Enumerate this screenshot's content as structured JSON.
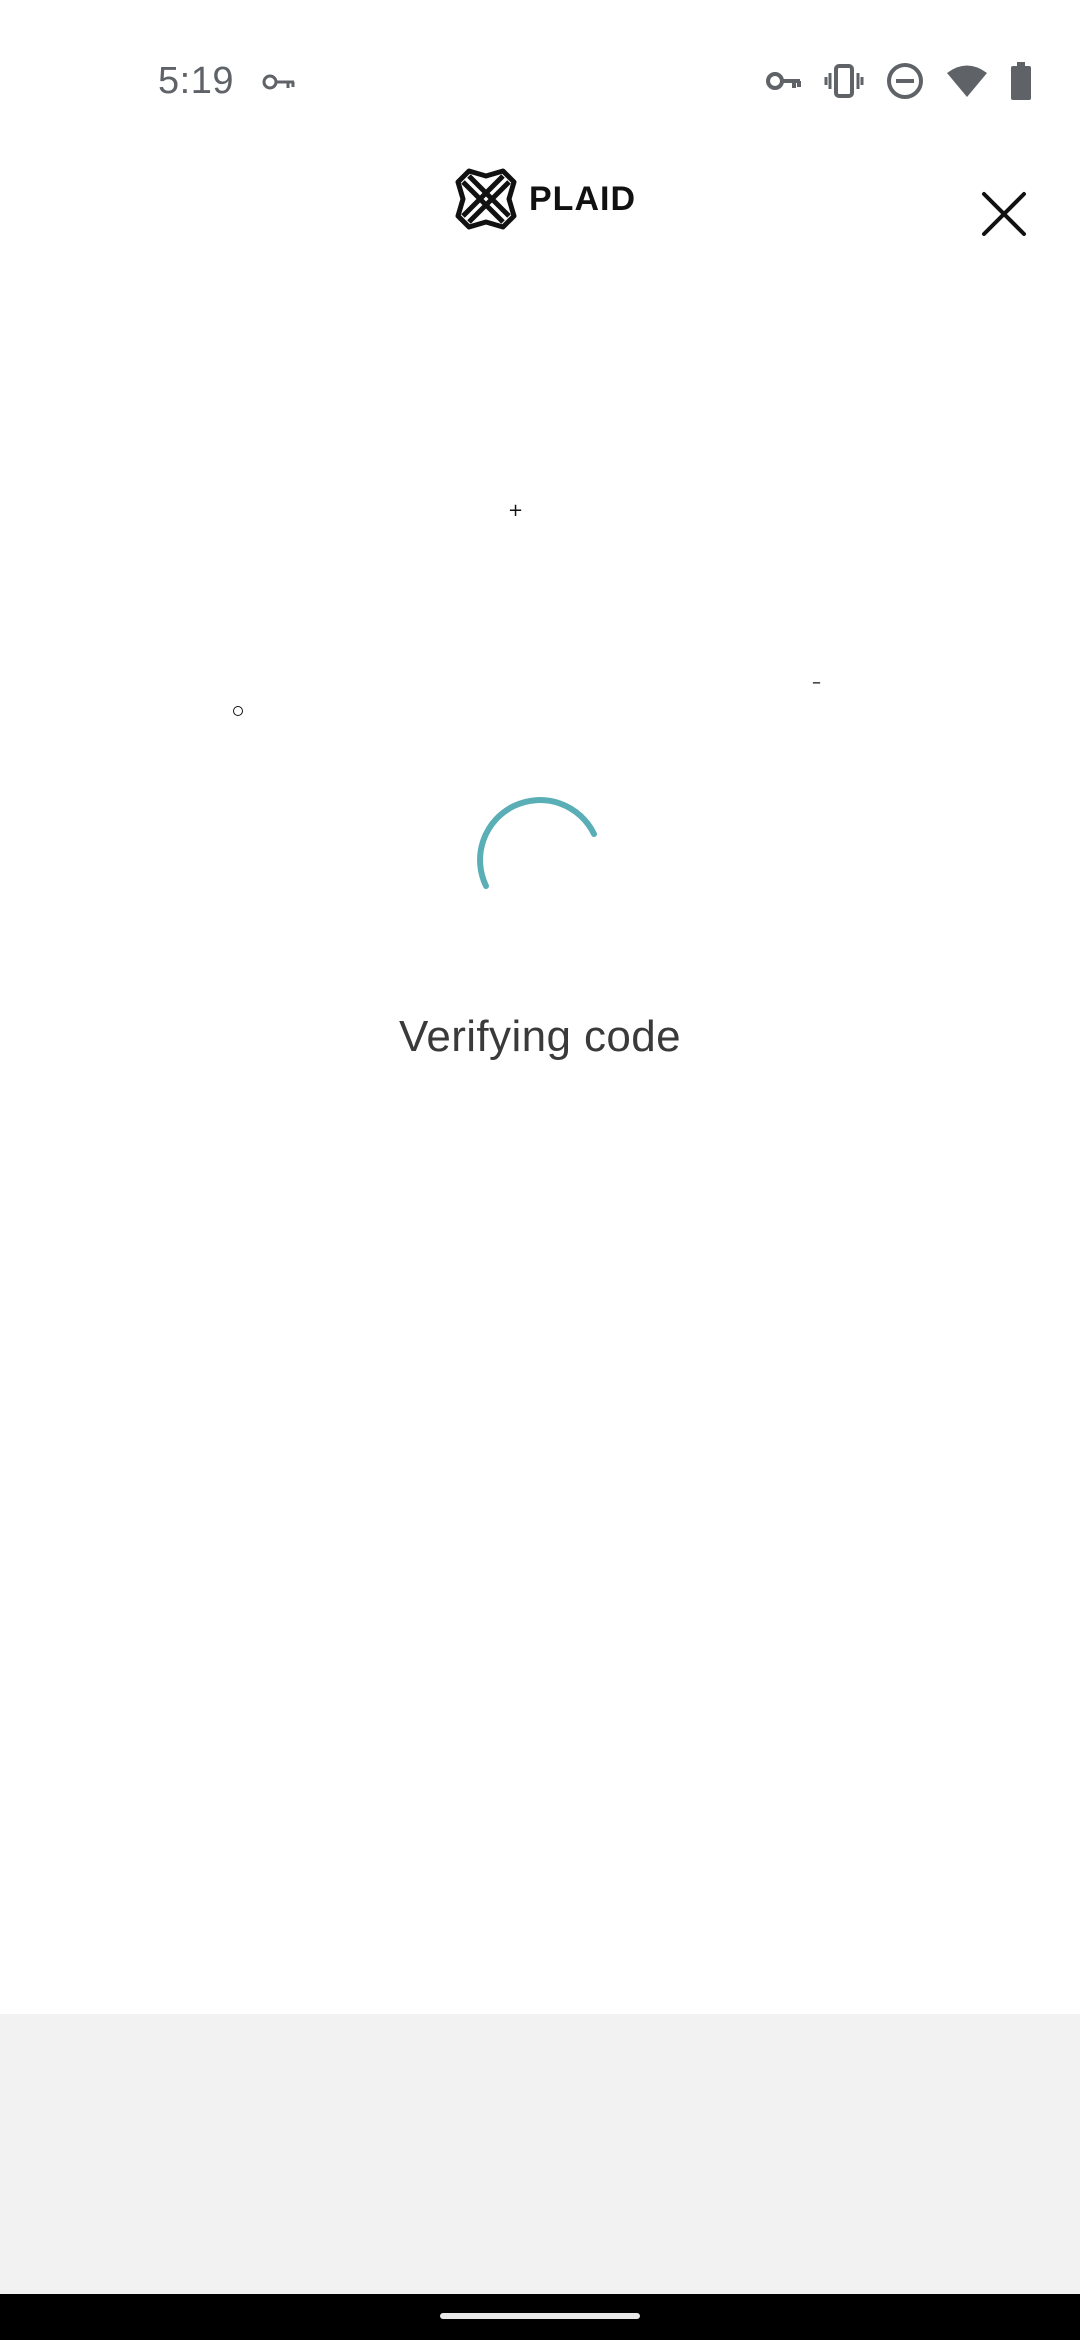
{
  "status_bar": {
    "time": "5:19",
    "left_icons": [
      "vpn-key-icon"
    ],
    "right_icons": [
      "vpn-key-icon",
      "vibrate-icon",
      "do-not-disturb-icon",
      "wifi-icon",
      "battery-icon"
    ]
  },
  "header": {
    "brand": "PLAID",
    "close_icon": "close-icon"
  },
  "main": {
    "status_text": "Verifying code",
    "spinner_color": "#5aafb6"
  },
  "colors": {
    "background": "#ffffff",
    "bottom_panel": "#f2f2f2",
    "nav_bar": "#000000",
    "brand_black": "#111111"
  }
}
